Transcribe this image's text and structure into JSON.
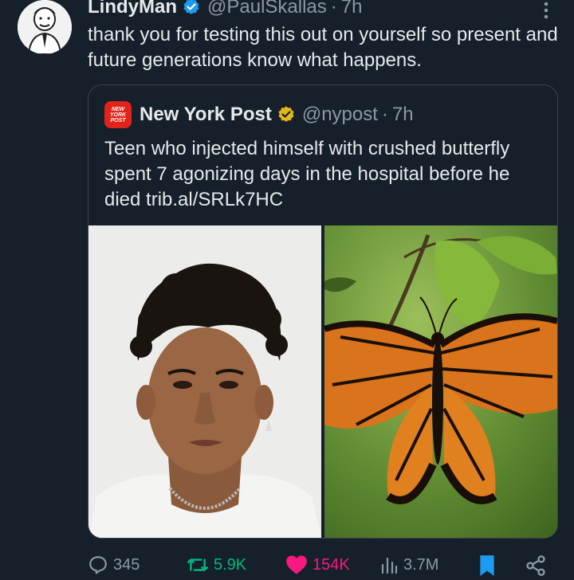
{
  "tweet": {
    "author_name": "LindyMan",
    "author_handle": "@PaulSkallas",
    "separator": "·",
    "time": "7h",
    "text": "thank you for testing this out on yourself so present and future generations know what happens."
  },
  "quote": {
    "author_name": "New York Post",
    "author_handle": "@nypost",
    "separator": "·",
    "time": "7h",
    "logo_lines": [
      "NEW",
      "YORK",
      "POST"
    ],
    "text": "Teen who injected himself with crushed butterfly spent 7 agonizing days in the hospital before he died trib.al/SRLk7HC"
  },
  "actions": {
    "replies": "345",
    "retweets": "5.9K",
    "likes": "154K",
    "views": "3.7M"
  },
  "icons": {
    "verified": "blue-verified-badge",
    "org_verified": "gold-verified-badge",
    "more": "vertical-ellipsis-icon",
    "reply": "speech-bubble-icon",
    "retweet": "retweet-arrows-icon",
    "like": "heart-filled-icon",
    "views": "bar-chart-icon",
    "bookmark": "bookmark-filled-icon",
    "share": "share-nodes-icon"
  },
  "colors": {
    "background": "#15202b",
    "text": "#e7e9ea",
    "muted": "#8b98a5",
    "verified_blue": "#1d9bf0",
    "verified_gold": "#e2b719",
    "retweet_green": "#00ba7c",
    "like_pink": "#f91880",
    "nyp_red": "#e2231a"
  }
}
